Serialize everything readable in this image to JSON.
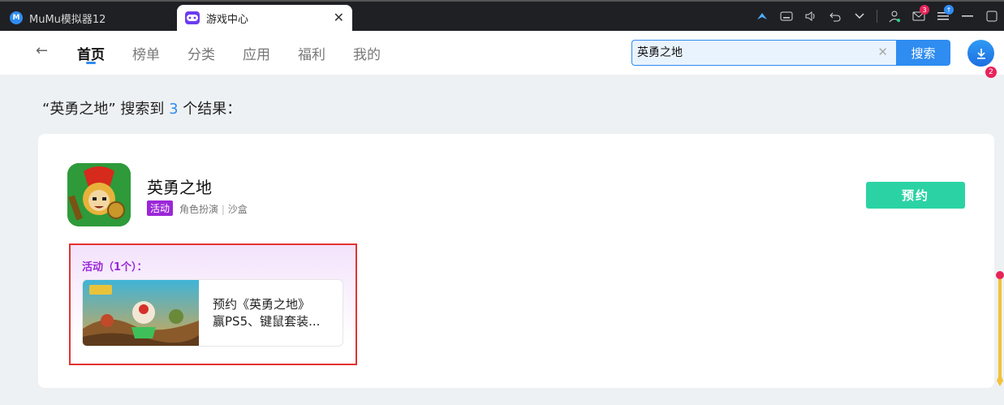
{
  "window": {
    "tabs": [
      {
        "label": "MuMu模拟器12"
      },
      {
        "label": "游戏中心"
      }
    ],
    "close_symbol": "✕",
    "toolbar_icons": [
      {
        "name": "pin-icon"
      },
      {
        "name": "keyboard-icon"
      },
      {
        "name": "volume-icon"
      },
      {
        "name": "undo-icon"
      },
      {
        "name": "chevron-down-icon"
      },
      {
        "name": "user-icon"
      },
      {
        "name": "mail-icon",
        "badge": "3"
      },
      {
        "name": "menu-icon"
      },
      {
        "name": "minimize-icon"
      },
      {
        "name": "maximize-icon"
      }
    ]
  },
  "nav": {
    "back_symbol": "←",
    "items": [
      {
        "label": "首页",
        "active": true
      },
      {
        "label": "榜单"
      },
      {
        "label": "分类"
      },
      {
        "label": "应用"
      },
      {
        "label": "福利"
      },
      {
        "label": "我的"
      }
    ],
    "search_value": "英勇之地",
    "search_button": "搜索",
    "download_badge": "2"
  },
  "results": {
    "prefix": "“英勇之地” 搜索到 ",
    "count": "3",
    "suffix": " 个结果："
  },
  "game": {
    "name": "英勇之地",
    "tag": "活动",
    "genre1": "角色扮演",
    "separator": "|",
    "genre2": "沙盒",
    "action": "预约",
    "activity_header": "活动（1个）：",
    "event_line1": "预约《英勇之地》",
    "event_line2": "赢PS5、键鼠套装..."
  },
  "colors": {
    "accent": "#2f8cf0",
    "reserve": "#2bd3a4",
    "activity_purple": "#9b27d8",
    "highlight_red": "#e53232"
  }
}
